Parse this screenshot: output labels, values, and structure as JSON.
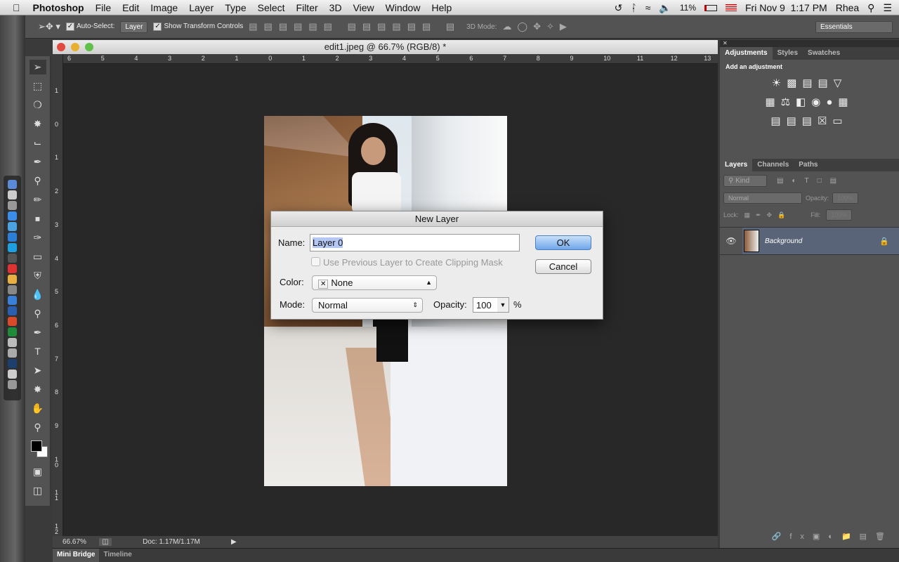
{
  "menubar": {
    "app": "Photoshop",
    "items": [
      "File",
      "Edit",
      "Image",
      "Layer",
      "Type",
      "Select",
      "Filter",
      "3D",
      "View",
      "Window",
      "Help"
    ],
    "battery": "11%",
    "datetime": "Fri Nov 9  1:17 PM",
    "user": "Rhea"
  },
  "options": {
    "auto_select_label": "Auto-Select:",
    "auto_select_value": "Layer",
    "show_transform": "Show Transform Controls",
    "mode3d": "3D Mode:",
    "workspace": "Essentials"
  },
  "document": {
    "title": "edit1.jpeg @ 66.7% (RGB/8) *",
    "zoom": "66.67%",
    "doc_size": "Doc: 1.17M/1.17M",
    "ruler_top": [
      "6",
      "5",
      "4",
      "3",
      "2",
      "1",
      "0",
      "1",
      "2",
      "3",
      "4",
      "5",
      "6",
      "7",
      "8",
      "9",
      "10",
      "11",
      "12",
      "13"
    ],
    "ruler_left": [
      "1",
      "0",
      "1",
      "2",
      "3",
      "4",
      "5",
      "6",
      "7",
      "8",
      "9",
      "1 0",
      "1 1",
      "1 2"
    ]
  },
  "bottom_tabs": [
    "Mini Bridge",
    "Timeline"
  ],
  "adjustments": {
    "tabs": [
      "Adjustments",
      "Styles",
      "Swatches"
    ],
    "heading": "Add an adjustment"
  },
  "layers": {
    "tabs": [
      "Layers",
      "Channels",
      "Paths"
    ],
    "filter": "Kind",
    "blend": "Normal",
    "opacity_label": "Opacity:",
    "opacity": "100%",
    "lock_label": "Lock:",
    "fill_label": "Fill:",
    "fill": "100%",
    "items": [
      {
        "name": "Background",
        "locked": true,
        "visible": true
      }
    ]
  },
  "dialog": {
    "title": "New Layer",
    "name_label": "Name:",
    "name_value": "Layer 0",
    "clip_label": "Use Previous Layer to Create Clipping Mask",
    "color_label": "Color:",
    "color_value": "None",
    "mode_label": "Mode:",
    "mode_value": "Normal",
    "opacity_label": "Opacity:",
    "opacity_value": "100",
    "percent": "%",
    "ok": "OK",
    "cancel": "Cancel"
  }
}
